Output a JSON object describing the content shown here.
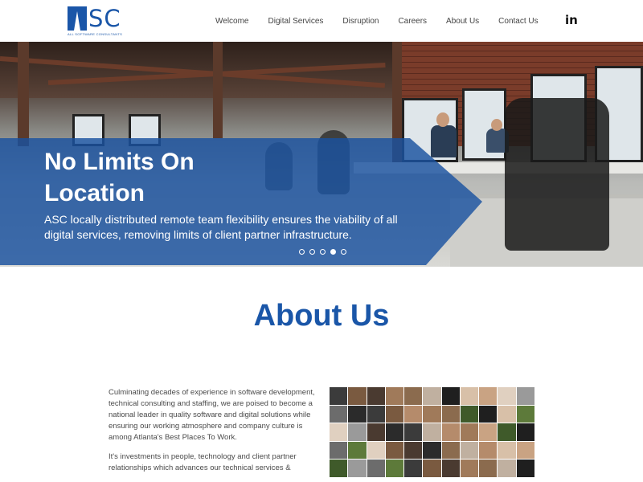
{
  "header": {
    "logo": {
      "mark_text": "SC",
      "subtitle": "ALL SOFTWARE CONSULTANTS"
    },
    "nav": [
      "Welcome",
      "Digital Services",
      "Disruption",
      "Careers",
      "About Us",
      "Contact Us"
    ],
    "social_icon_text": "in"
  },
  "hero": {
    "title": "No Limits On Location",
    "text": "ASC locally distributed remote team flexibility ensures the viability of all digital services, removing limits of client partner infrastructure.",
    "slide_count": 5,
    "active_slide": 4
  },
  "about": {
    "title": "About Us",
    "paragraphs": [
      "Culminating decades of experience in software development, technical consulting and staffing, we are poised to become a national leader in quality software and digital solutions while ensuring our working atmosphere and company culture is among Atlanta's Best Places To Work.",
      "It's investments in people, technology and client partner relationships which advances our technical services &"
    ]
  },
  "colors": {
    "brand_blue": "#1a56a8",
    "hero_overlay": "#1a52a0"
  }
}
